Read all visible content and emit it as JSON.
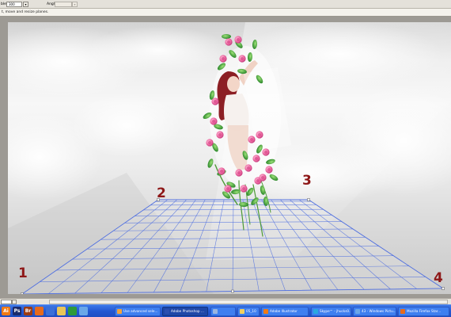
{
  "options_bar": {
    "field_label": "ble:",
    "field_value": "300",
    "angle_label": "Angle:",
    "angle_value": ""
  },
  "hint": "t, move and resize planes.",
  "markers": [
    "1",
    "2",
    "3",
    "4"
  ],
  "taskbar": {
    "quick_launch": [
      {
        "icon": "adobe-ai-icon",
        "label": "Ai",
        "color": "#f07a14"
      },
      {
        "icon": "adobe-ps-icon",
        "label": "Ps",
        "color": "#1b2a6b"
      },
      {
        "icon": "adobe-br-icon",
        "label": "Br",
        "color": "#9c3b12"
      },
      {
        "icon": "firefox-icon",
        "label": "",
        "color": "#e66a1c"
      },
      {
        "icon": "browser-icon",
        "label": "",
        "color": "#3a6fd8"
      },
      {
        "icon": "folder-icon",
        "label": "",
        "color": "#e8c558"
      },
      {
        "icon": "media-icon",
        "label": "",
        "color": "#2f9a3a"
      },
      {
        "icon": "explorer-icon",
        "label": "",
        "color": "#6aa7e8"
      }
    ],
    "tasks": [
      {
        "label": "Use advanced sele...",
        "color": "#f2a33a",
        "active": false
      },
      {
        "label": "Adobe Photoshop ...",
        "color": "#2b4fb0",
        "active": true
      },
      {
        "label": "",
        "color": "#9ab6e0",
        "active": false
      },
      {
        "label": "05_10",
        "color": "#f0d060",
        "active": false
      },
      {
        "label": "Adobe Illustrator",
        "color": "#f07a14",
        "active": false
      },
      {
        "label": "Skype™ - jhucks0...",
        "color": "#2aa8e0",
        "active": false
      },
      {
        "label": "43 - Windows Pictu...",
        "color": "#6aa7e8",
        "active": false
      },
      {
        "label": "Mozilla Firefox Star...",
        "color": "#e66a1c",
        "active": false
      }
    ]
  }
}
